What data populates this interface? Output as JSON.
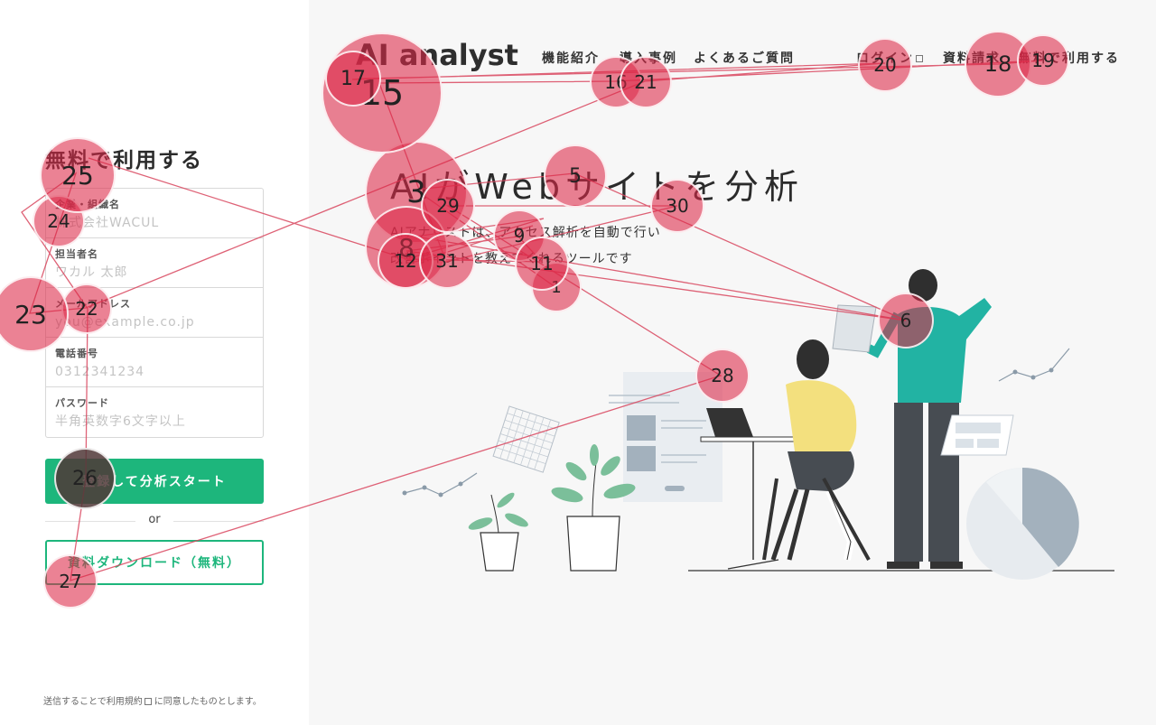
{
  "form": {
    "title": "無料で利用する",
    "fields": [
      {
        "label": "企業・組織名",
        "placeholder": "株式会社WACUL"
      },
      {
        "label": "担当者名",
        "placeholder": "ワカル 太郎"
      },
      {
        "label": "メールアドレス",
        "placeholder": "you@example.co.jp"
      },
      {
        "label": "電話番号",
        "placeholder": "0312341234"
      },
      {
        "label": "パスワード",
        "placeholder": "半角英数字6文字以上"
      }
    ],
    "submit_label": "登録して分析スタート",
    "or_label": "or",
    "download_label": "資料ダウンロード（無料）",
    "terms_prefix": "送信することで",
    "terms_link": "利用規約",
    "terms_suffix": "に同意したものとします。"
  },
  "header": {
    "logo": "AI analyst",
    "nav": [
      "機能紹介",
      "導入事例",
      "よくあるご質問"
    ],
    "login": "ログイン",
    "request_docs": "資料請求",
    "free_use": "無料で利用する"
  },
  "hero": {
    "title": "AIがWebサイトを分析",
    "subtitle_line1": "AIアナリストは、アクセス解析を自動で行い",
    "subtitle_line2": "改善ポイントを教えてくれるツールです"
  },
  "gaze_points": [
    {
      "n": "1"
    },
    {
      "n": "3"
    },
    {
      "n": "5"
    },
    {
      "n": "6"
    },
    {
      "n": "8"
    },
    {
      "n": "9"
    },
    {
      "n": "11"
    },
    {
      "n": "12"
    },
    {
      "n": "15"
    },
    {
      "n": "16"
    },
    {
      "n": "17"
    },
    {
      "n": "18"
    },
    {
      "n": "19"
    },
    {
      "n": "20"
    },
    {
      "n": "21"
    },
    {
      "n": "22"
    },
    {
      "n": "23"
    },
    {
      "n": "24"
    },
    {
      "n": "25"
    },
    {
      "n": "26"
    },
    {
      "n": "27"
    },
    {
      "n": "28"
    },
    {
      "n": "29"
    },
    {
      "n": "30"
    },
    {
      "n": "31"
    }
  ],
  "colors": {
    "accent": "#1db67c",
    "gaze": "#dc2846",
    "panel_bg": "#f7f7f7"
  }
}
